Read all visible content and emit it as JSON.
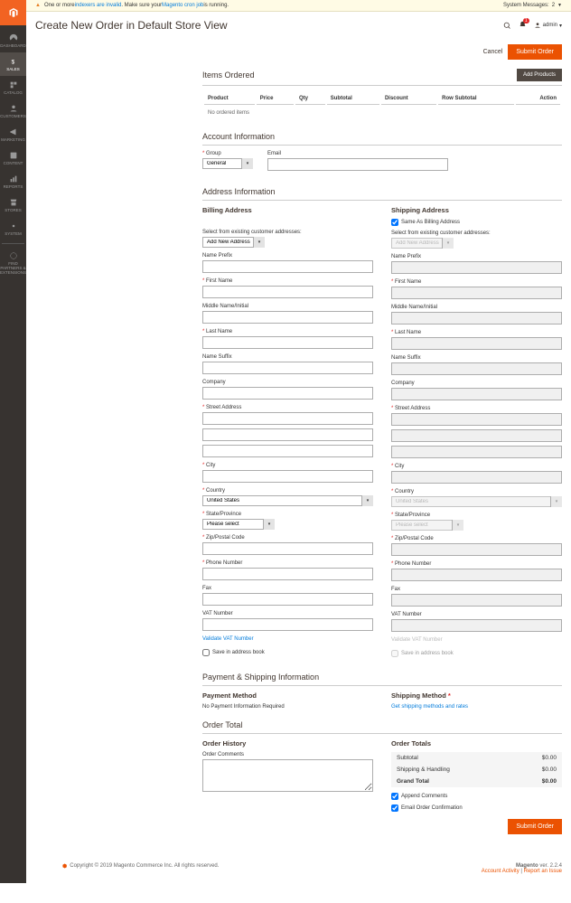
{
  "sysmsg": {
    "text1": "One or more ",
    "link1": "indexers are invalid",
    "text2": ". Make sure your ",
    "link2": "Magento cron job",
    "text3": " is running.",
    "right_label": "System Messages:",
    "right_count": "2"
  },
  "header": {
    "title": "Create New Order in Default Store View",
    "notif_count": "1",
    "admin": "admin"
  },
  "actions": {
    "cancel": "Cancel",
    "submit": "Submit Order"
  },
  "items": {
    "title": "Items Ordered",
    "add": "Add Products",
    "cols": {
      "product": "Product",
      "price": "Price",
      "qty": "Qty",
      "subtotal": "Subtotal",
      "discount": "Discount",
      "rowsub": "Row Subtotal",
      "action": "Action"
    },
    "empty": "No ordered items"
  },
  "account": {
    "title": "Account Information",
    "group_label": "Group",
    "group_value": "General",
    "email_label": "Email"
  },
  "address": {
    "title": "Address Information",
    "billing_title": "Billing Address",
    "shipping_title": "Shipping Address",
    "same_as": "Same As Billing Address",
    "select_existing": "Select from existing customer addresses:",
    "add_new": "Add New Address",
    "labels": {
      "prefix": "Name Prefix",
      "first": "First Name",
      "middle": "Middle Name/Initial",
      "last": "Last Name",
      "suffix": "Name Suffix",
      "company": "Company",
      "street": "Street Address",
      "city": "City",
      "country": "Country",
      "state": "State/Province",
      "zip": "Zip/Postal Code",
      "phone": "Phone Number",
      "fax": "Fax",
      "vat": "VAT Number"
    },
    "country_value": "United States",
    "state_value": "Please select",
    "validate_vat": "Validate VAT Number",
    "save_book": "Save in address book"
  },
  "payship": {
    "title": "Payment & Shipping Information",
    "payment_title": "Payment Method",
    "payment_msg": "No Payment Information Required",
    "shipping_title": "Shipping Method",
    "shipping_link": "Get shipping methods and rates"
  },
  "ordertotal": {
    "title": "Order Total",
    "history_title": "Order History",
    "comments_label": "Order Comments",
    "totals_title": "Order Totals",
    "rows": {
      "subtotal_label": "Subtotal",
      "subtotal_val": "$0.00",
      "ship_label": "Shipping & Handling",
      "ship_val": "$0.00",
      "grand_label": "Grand Total",
      "grand_val": "$0.00"
    },
    "append": "Append Comments",
    "emailconf": "Email Order Confirmation"
  },
  "footer": {
    "copyright": "Copyright © 2019 Magento Commerce Inc. All rights reserved.",
    "version_label": "Magento",
    "version": "ver. 2.2.4",
    "activity": "Account Activity",
    "report": "Report an Issue"
  },
  "nav": {
    "dashboard": "DASHBOARD",
    "sales": "SALES",
    "catalog": "CATALOG",
    "customers": "CUSTOMERS",
    "marketing": "MARKETING",
    "content": "CONTENT",
    "reports": "REPORTS",
    "stores": "STORES",
    "system": "SYSTEM",
    "partners": "FIND PARTNERS & EXTENSIONS"
  }
}
